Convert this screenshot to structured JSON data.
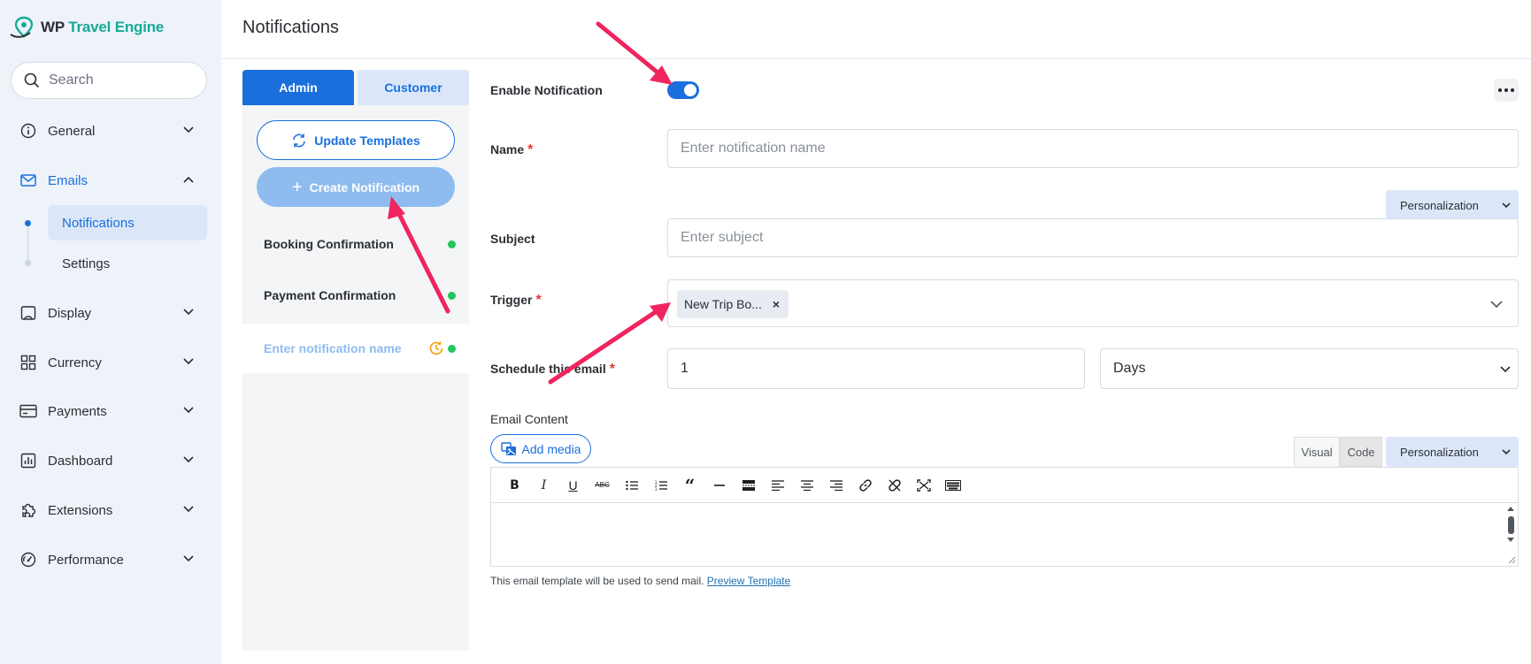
{
  "app": {
    "logo_prefix": "WP",
    "logo_accent": "Travel Engine",
    "brand_color": "#1a6fdc",
    "accent_color": "#18a999"
  },
  "search": {
    "placeholder": "Search"
  },
  "sidebar": {
    "items": [
      {
        "label": "General",
        "icon": "info-icon"
      },
      {
        "label": "Emails",
        "icon": "mail-icon"
      },
      {
        "label": "Display",
        "icon": "display-icon"
      },
      {
        "label": "Currency",
        "icon": "grid-icon"
      },
      {
        "label": "Payments",
        "icon": "card-icon"
      },
      {
        "label": "Dashboard",
        "icon": "chart-icon"
      },
      {
        "label": "Extensions",
        "icon": "puzzle-icon"
      },
      {
        "label": "Performance",
        "icon": "gauge-icon"
      }
    ],
    "sub_items": [
      {
        "label": "Notifications"
      },
      {
        "label": "Settings"
      }
    ]
  },
  "header": {
    "title": "Notifications"
  },
  "tabs": {
    "admin": "Admin",
    "customer": "Customer"
  },
  "actions": {
    "update_templates": "Update Templates",
    "create_notification": "Create Notification"
  },
  "notifications": [
    {
      "label": "Booking Confirmation"
    },
    {
      "label": "Payment Confirmation"
    },
    {
      "label": "Enter notification name"
    }
  ],
  "form": {
    "enable_label": "Enable Notification",
    "enabled": true,
    "name_label": "Name",
    "required_mark": "*",
    "name_placeholder": "Enter notification name",
    "personalization_label": "Personalization",
    "subject_label": "Subject",
    "subject_placeholder": "Enter subject",
    "trigger_label": "Trigger",
    "trigger_chip": "New Trip Bo...",
    "trigger_chip_remove": "×",
    "schedule_label": "Schedule this email",
    "schedule_value": "1",
    "schedule_unit": "Days",
    "content_label": "Email Content",
    "add_media": "Add media",
    "editor_tab_visual": "Visual",
    "editor_tab_code": "Code",
    "helper_text": "This email template will be used to send mail.",
    "preview_link": "Preview Template"
  },
  "toolbar": [
    "B",
    "I",
    "U",
    "ABC",
    "ul",
    "ol",
    "quote",
    "hr",
    "more",
    "align-left",
    "align-center",
    "align-right",
    "link",
    "unlink",
    "fullscreen",
    "kitchen-sink"
  ]
}
